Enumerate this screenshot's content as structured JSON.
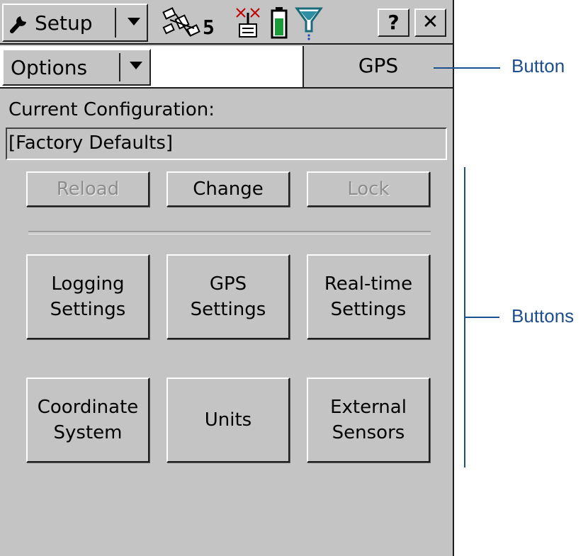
{
  "toolbar": {
    "setup_label": "Setup",
    "satellite_count": "5",
    "help_label": "?",
    "close_label": "✕"
  },
  "options_bar": {
    "options_label": "Options",
    "gps_label": "GPS"
  },
  "configuration": {
    "label": "Current Configuration:",
    "value": "[Factory Defaults]"
  },
  "action_buttons": {
    "reload": "Reload",
    "change": "Change",
    "lock": "Lock"
  },
  "settings_buttons": {
    "logging": "Logging\nSettings",
    "gps": "GPS\nSettings",
    "realtime": "Real-time\nSettings",
    "coordinate": "Coordinate\nSystem",
    "units": "Units",
    "external": "External\nSensors"
  },
  "annotations": {
    "button": "Button",
    "buttons": "Buttons"
  },
  "colors": {
    "panel_bg": "#c4c4c4",
    "annotation": "#1f4e8c",
    "disabled_text": "#8c8c8c"
  },
  "icons": [
    "wrench-icon",
    "dropdown-arrow-icon",
    "satellite-icon",
    "radio-icon",
    "battery-icon",
    "filter-icon",
    "help-icon",
    "close-icon"
  ]
}
